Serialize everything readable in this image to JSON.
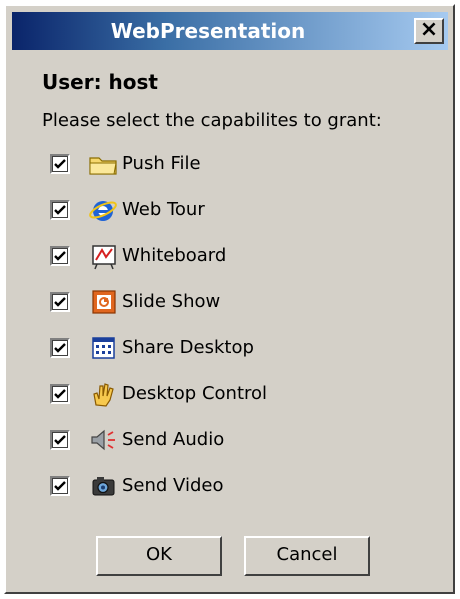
{
  "window": {
    "title": "WebPresentation",
    "close_label": "×"
  },
  "user_label": "User: host",
  "instruction": "Please select the capabilites to grant:",
  "capabilities": [
    {
      "label": "Push File",
      "checked": true,
      "icon": "folder-icon"
    },
    {
      "label": "Web Tour",
      "checked": true,
      "icon": "internet-explorer-icon"
    },
    {
      "label": "Whiteboard",
      "checked": true,
      "icon": "whiteboard-icon"
    },
    {
      "label": "Slide Show",
      "checked": true,
      "icon": "slideshow-icon"
    },
    {
      "label": "Share Desktop",
      "checked": true,
      "icon": "share-desktop-icon"
    },
    {
      "label": "Desktop Control",
      "checked": true,
      "icon": "hand-icon"
    },
    {
      "label": "Send Audio",
      "checked": true,
      "icon": "speaker-icon"
    },
    {
      "label": "Send Video",
      "checked": true,
      "icon": "camera-icon"
    }
  ],
  "buttons": {
    "ok_label": "OK",
    "cancel_label": "Cancel"
  },
  "colors": {
    "dialog_bg": "#d4d0c8",
    "title_gradient_start": "#0a246a",
    "title_gradient_end": "#a6caf0"
  }
}
